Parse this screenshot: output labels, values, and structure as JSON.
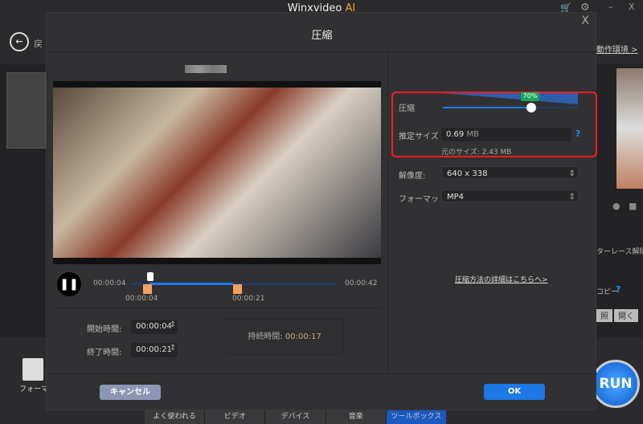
{
  "app": {
    "title": "Winxvideo",
    "title_accent": "AI",
    "accent": "#f0a030"
  },
  "background": {
    "back_label": "戻",
    "env_link": "動作環境 >",
    "format_label": "フォーマット",
    "deinterlace": "ターレース解除",
    "copy": "コピー",
    "help": "?",
    "browse": "照",
    "open": "開く",
    "run": "RUN",
    "tabs": [
      "よく使われる",
      "ビデオ",
      "デバイス",
      "音楽",
      "ツールボックス"
    ]
  },
  "dialog": {
    "title": "圧縮",
    "close": "X",
    "player": {
      "current": "00:00:04",
      "total": "00:00:42",
      "start_marker": "00:00:04",
      "end_marker": "00:00:21",
      "progress": 0.1,
      "trim_start": 0.095,
      "trim_end": 0.5
    },
    "trim": {
      "start_label": "開始時間:",
      "start_value": "00:00:04",
      "end_label": "終了時間:",
      "end_value": "00:00:21",
      "duration_label": "持続時間:",
      "duration_value": "00:00:17"
    },
    "compress": {
      "label": "圧縮",
      "percent_badge": "70%",
      "level": 0.7,
      "est_label": "推定サイズ",
      "est_value": "0.69",
      "est_unit": "MB",
      "help": "?",
      "original": "元のサイズ: 2.43 MB"
    },
    "resolution": {
      "label": "解像度:",
      "value": "640 x 338"
    },
    "format": {
      "label": "フォーマット:",
      "value": "MP4"
    },
    "details_link": "圧縮方法の詳細はこちらへ>",
    "cancel": "キャンセル",
    "ok": "OK",
    "highlight_color": "#ff1a1a"
  }
}
